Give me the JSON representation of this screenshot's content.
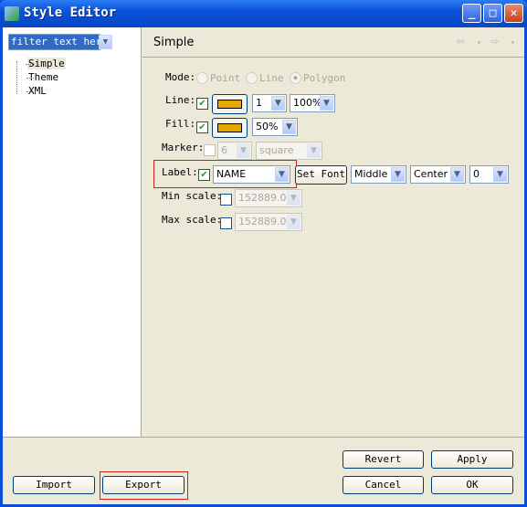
{
  "window": {
    "title": "Style Editor",
    "minimize": "_",
    "maximize": "□",
    "close": "✕"
  },
  "sidebar": {
    "filter_placeholder": "filter text here",
    "items": [
      {
        "label": "Simple",
        "selected": true
      },
      {
        "label": "Theme"
      },
      {
        "label": "XML"
      }
    ]
  },
  "page": {
    "title": "Simple",
    "back_icon": "⇦",
    "forward_icon": "⇨"
  },
  "form": {
    "mode": {
      "label": "Mode:",
      "options": [
        "Point",
        "Line",
        "Polygon"
      ],
      "selected": "Polygon",
      "enabled": false
    },
    "line": {
      "label": "Line:",
      "checked": true,
      "color": "#e6a800",
      "width": "1",
      "opacity": "100%"
    },
    "fill": {
      "label": "Fill:",
      "checked": true,
      "color": "#e6a800",
      "opacity": "50%"
    },
    "marker": {
      "label": "Marker:",
      "checked": false,
      "size": "6",
      "shape": "square",
      "enabled": false
    },
    "label": {
      "label": "Label:",
      "checked": true,
      "field": "NAME",
      "set_font": "Set Font",
      "vertical": "Middle",
      "horizontal": "Center",
      "rotation": "0"
    },
    "min_scale": {
      "label": "Min scale:",
      "checked": false,
      "value": "152889.0"
    },
    "max_scale": {
      "label": "Max scale:",
      "checked": false,
      "value": "152889.0"
    }
  },
  "buttons": {
    "revert": "Revert",
    "apply": "Apply",
    "cancel": "Cancel",
    "ok": "OK",
    "import": "Import",
    "export": "Export"
  },
  "colors": {
    "highlight": "#d02020",
    "swatch": "#e6a800"
  }
}
